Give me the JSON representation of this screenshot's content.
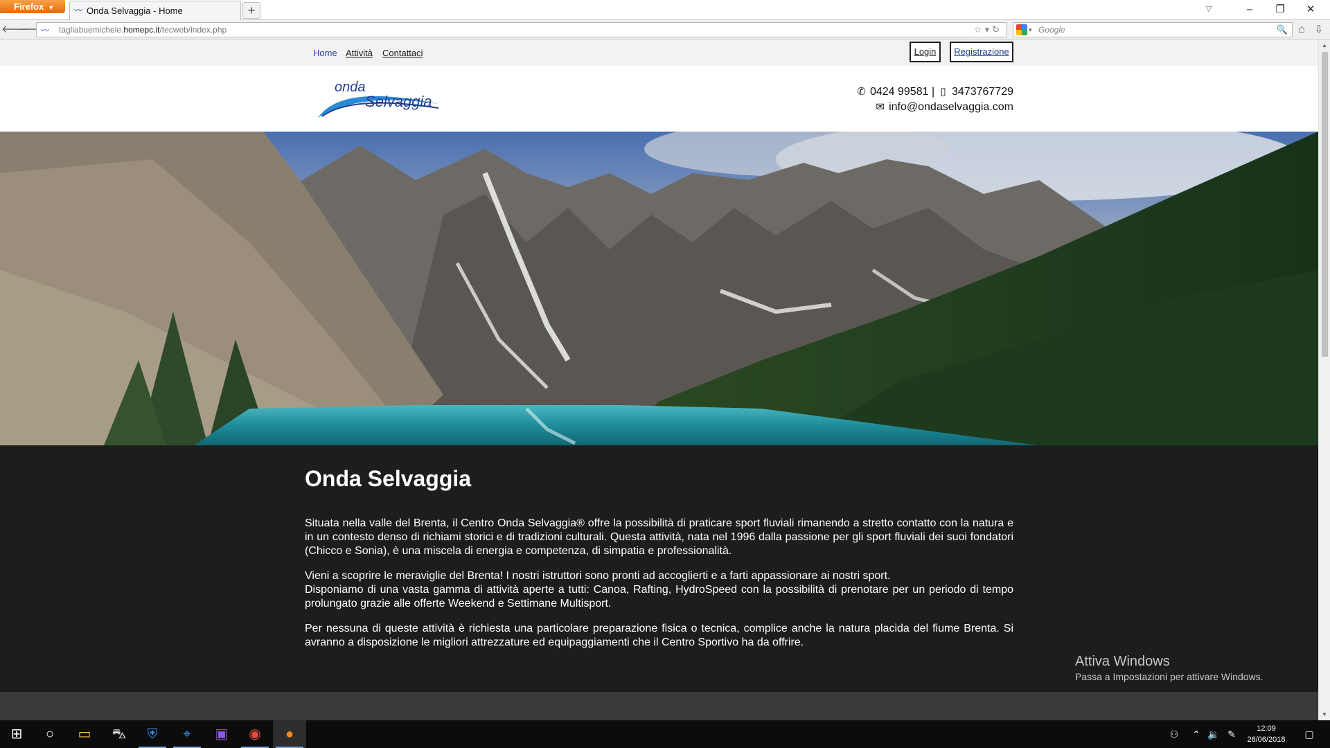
{
  "browser": {
    "menu_button": "Firefox",
    "tab_title": "Onda Selvaggia - Home",
    "new_tab": "+",
    "url_prefix": "tagliabuemichele.",
    "url_host": "homepc.it",
    "url_path": "/tecweb/index.php",
    "search_placeholder": "Google"
  },
  "site": {
    "nav": {
      "home": "Home",
      "attivita": "Attività",
      "contattaci": "Contattaci"
    },
    "auth": {
      "login": "Login",
      "register": "Registrazione"
    },
    "logo": {
      "top": "onda",
      "bottom": "Selvaggia",
      "colors": {
        "text": "#1f3f92",
        "wave": "#2a8ad6"
      }
    },
    "contact": {
      "phone": "0424 99581",
      "separator": "|",
      "mobile": "3473767729",
      "email": "info@ondaselvaggia.com"
    },
    "hero_alt": "Lago di montagna con foresta",
    "main": {
      "title": "Onda Selvaggia",
      "paragraphs": [
        "Situata nella valle del Brenta, il Centro Onda Selvaggia® offre la possibilità di praticare sport fluviali rimanendo a stretto contatto con la natura e in un contesto denso di richiami storici e di tradizioni culturali. Questa attività, nata nel 1996 dalla passione per gli sport fluviali dei suoi fondatori (Chicco e Sonia), è una miscela di energia e competenza, di simpatia e professionalità.",
        "Vieni a scoprire le meraviglie del Brenta! I nostri istruttori sono pronti ad accoglierti e a farti appassionare ai nostri sport.",
        "Disponiamo di una vasta gamma di attività aperte a tutti: Canoa, Rafting, HydroSpeed con la possibilità di prenotare per un periodo di tempo prolungato grazie alle offerte Weekend e Settimane Multisport.",
        "Per nessuna di queste attività è richiesta una particolare preparazione fisica o tecnica, complice anche la natura placida del fiume Brenta. Si avranno a disposizione le migliori attrezzature ed equipaggiamenti che il Centro Sportivo ha da offrire."
      ]
    }
  },
  "watermark": {
    "title": "Attiva Windows",
    "subtitle": "Passa a Impostazioni per attivare Windows."
  },
  "taskbar": {
    "time": "12:09",
    "date": "26/06/2018"
  },
  "colors": {
    "accent_orange": "#e66c10",
    "link_blue": "#2a3fa3",
    "content_bg": "#1d1d1d"
  }
}
